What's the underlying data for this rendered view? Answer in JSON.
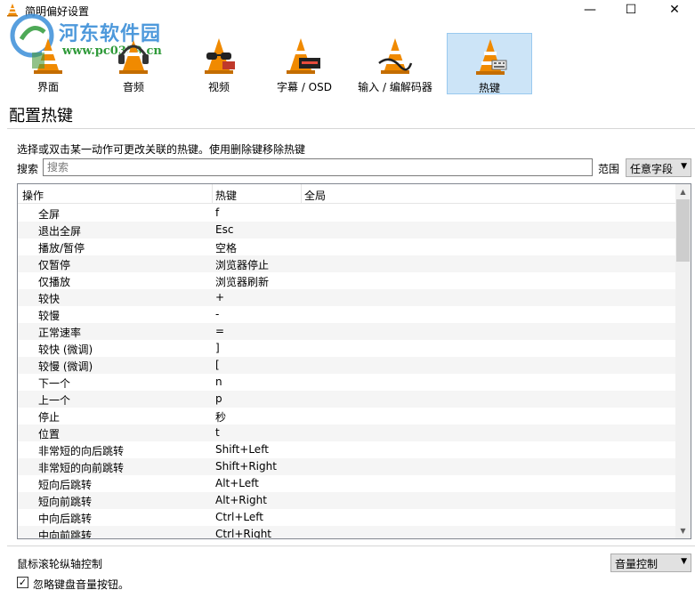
{
  "window": {
    "title": "简明偏好设置",
    "minimize_glyph": "—",
    "maximize_glyph": "☐",
    "close_glyph": "✕"
  },
  "watermark": {
    "title": "河东软件园",
    "url": "www.pc0359.cn"
  },
  "categories": [
    {
      "label": "界面",
      "icon": "interface-cone-icon",
      "selected": false
    },
    {
      "label": "音频",
      "icon": "audio-headphones-cone-icon",
      "selected": false
    },
    {
      "label": "视频",
      "icon": "video-glasses-cone-icon",
      "selected": false
    },
    {
      "label": "字幕 / OSD",
      "icon": "subtitles-cone-icon",
      "selected": false
    },
    {
      "label": "输入 / 编解码器",
      "icon": "input-codecs-cone-icon",
      "selected": false
    },
    {
      "label": "热键",
      "icon": "hotkeys-cone-icon",
      "selected": true
    }
  ],
  "section": {
    "title": "配置热键",
    "instruction": "选择或双击某一动作可更改关联的热键。使用删除键移除热键"
  },
  "search": {
    "label": "搜索",
    "placeholder": "搜索",
    "value": "",
    "scope_label": "范围",
    "scope_value": "任意字段"
  },
  "table": {
    "columns": [
      "操作",
      "热键",
      "全局"
    ],
    "rows": [
      {
        "action": "全屏",
        "hotkey": "f"
      },
      {
        "action": "退出全屏",
        "hotkey": "Esc"
      },
      {
        "action": "播放/暂停",
        "hotkey": "空格"
      },
      {
        "action": "仅暂停",
        "hotkey": "浏览器停止"
      },
      {
        "action": "仅播放",
        "hotkey": "浏览器刷新"
      },
      {
        "action": "较快",
        "hotkey": "+"
      },
      {
        "action": "较慢",
        "hotkey": "-"
      },
      {
        "action": "正常速率",
        "hotkey": "="
      },
      {
        "action": "较快 (微调)",
        "hotkey": "]"
      },
      {
        "action": "较慢 (微调)",
        "hotkey": "["
      },
      {
        "action": "下一个",
        "hotkey": "n"
      },
      {
        "action": "上一个",
        "hotkey": "p"
      },
      {
        "action": "停止",
        "hotkey": "秒"
      },
      {
        "action": "位置",
        "hotkey": "t"
      },
      {
        "action": "非常短的向后跳转",
        "hotkey": "Shift+Left"
      },
      {
        "action": "非常短的向前跳转",
        "hotkey": "Shift+Right"
      },
      {
        "action": "短向后跳转",
        "hotkey": "Alt+Left"
      },
      {
        "action": "短向前跳转",
        "hotkey": "Alt+Right"
      },
      {
        "action": "中向后跳转",
        "hotkey": "Ctrl+Left"
      },
      {
        "action": "中向前跳转",
        "hotkey": "Ctrl+Right"
      }
    ]
  },
  "mouse_wheel": {
    "label": "鼠标滚轮纵轴控制",
    "value": "音量控制"
  },
  "ignore_volume_keys": {
    "label": "忽略键盘音量按钮。",
    "checked": true,
    "check_glyph": "✓"
  },
  "colors": {
    "selected_category_bg": "#cce4f7",
    "cone_orange": "#f08a00",
    "watermark_blue": "#3b8ed8",
    "watermark_green": "#2f9a39"
  }
}
